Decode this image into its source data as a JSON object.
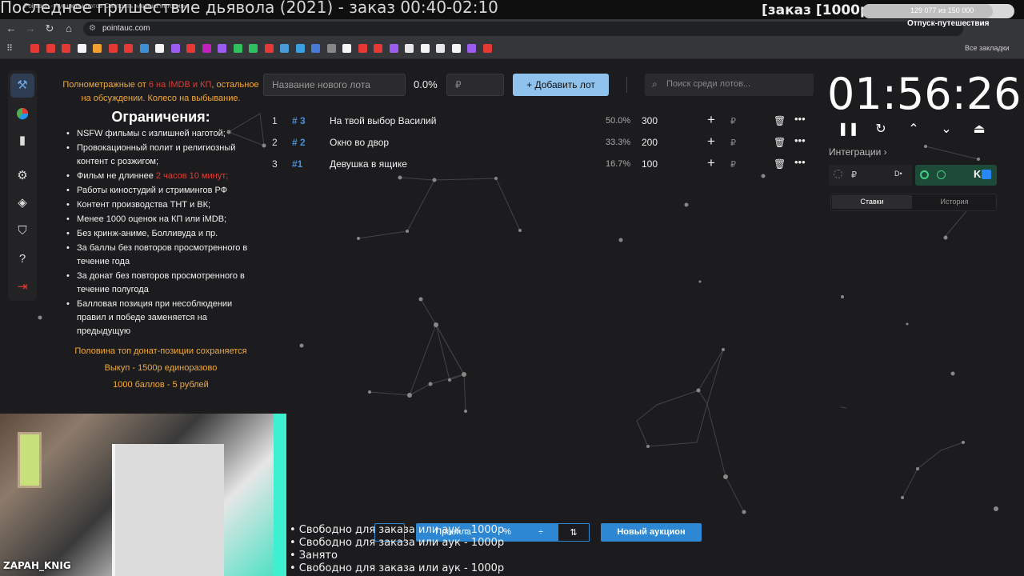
{
  "stream_overlay": {
    "title": "Последнее пришествие дьявола (2021) - заказ 00:40-02:10",
    "order_badge": "[заказ [1000р]",
    "progress_text": "129 077 из 150 000",
    "progress_fraction": 0.86,
    "ext_note": "Отпуск-путешествия",
    "lines": [
      "• Свободно для заказа или аук - 1000р",
      "• Свободно для заказа или аук - 1000р",
      "• Занято",
      "• Свободно для заказа или аук - 1000р"
    ],
    "cam_name": "ZAPAH_KNIG"
  },
  "browser": {
    "tab_strip": "Pointauc - Аукционы лотов    Смотреть «Анаша история»",
    "url": "pointauc.com",
    "all_bookmarks": "Все закладки",
    "bookmark_colors": [
      "#e53935",
      "#e53935",
      "#e53935",
      "#f5f5f5",
      "#f0a030",
      "#e53935",
      "#e53935",
      "#3f8fd8",
      "#f5f5f5",
      "#9c5cf0",
      "#e53935",
      "#c020c0",
      "#9c5cf0",
      "#30c060",
      "#30c060",
      "#e53935",
      "#4a9ad8",
      "#3aa0e0",
      "#4a7ad8",
      "#888888",
      "#f5f5f5",
      "#e53935",
      "#e53935",
      "#9c5cf0",
      "#e8e8e8",
      "#f5f5f5",
      "#e8e8e8",
      "#f5f5f5",
      "#9c5cf0",
      "#e53935"
    ]
  },
  "sidebar": {
    "icons": [
      "gavel-icon",
      "pie-chart-icon",
      "bar-chart-icon",
      "settings-icon",
      "layers-icon",
      "shield-icon",
      "help-icon",
      "logout-icon"
    ]
  },
  "rules": {
    "intro_pre": "Полнометражные от ",
    "intro_red": "6 на IMDB и КП",
    "intro_post": ", остальное на обсуждении. Колесо на выбывание.",
    "heading": "Ограничения:",
    "items": [
      "NSFW фильмы с излишней наготой;",
      "Провокационный полит и религиозный контент с розжигом;",
      "__length__",
      "Работы киностудий и стримингов РФ",
      "Контент производства ТНТ и ВК;",
      "Менее 1000 оценок на КП или iMDB;",
      "Без кринж-аниме, Болливуда и пр.",
      "За баллы без повторов просмотренного в течение года",
      "За донат без повторов просмотренного в течение полугода",
      "Балловая позиция при несоблюдении правил и победе заменяется на предыдущую"
    ],
    "length_pre": "Фильм не длиннее ",
    "length_red": "2 часов 10 минут;",
    "footer": [
      "Половина топ донат-позиции сохраняется",
      "Выкуп - 1500р единоразово",
      "1000 баллов - 5 рублей"
    ]
  },
  "toolbar": {
    "lot_name_placeholder": "Название нового лота",
    "percent": "0.0%",
    "amount_placeholder": "₽",
    "add_lot": "+  Добавить лот",
    "search_placeholder": "Поиск среди лотов..."
  },
  "lots": [
    {
      "idx": "1",
      "code": "# 3",
      "name": "На твой выбор Василий",
      "pct": "50.0%",
      "amount": "300"
    },
    {
      "idx": "2",
      "code": "# 2",
      "name": "Окно во двор",
      "pct": "33.3%",
      "amount": "200"
    },
    {
      "idx": "3",
      "code": "#1",
      "name": "Девушка в ящике",
      "pct": "16.7%",
      "amount": "100"
    }
  ],
  "lot_actions": {
    "plus": "+",
    "rub": "₽",
    "delete": "🗑",
    "more": "•••"
  },
  "timer": {
    "value": "01:56:26",
    "controls": [
      "pause-icon",
      "restart-icon",
      "chevron-up-icon",
      "chevron-down-icon",
      "eject-icon"
    ],
    "control_glyphs": [
      "❚❚",
      "↻",
      "⌃",
      "⌄",
      "⏏"
    ]
  },
  "integrations": {
    "label": "Интеграции  ›",
    "rub": "₽",
    "da": "D•",
    "vk": "K",
    "tabs": [
      "Ставки",
      "История"
    ]
  },
  "bottom_bar": {
    "rules_label": "Правила",
    "percent_glyph": "%",
    "divide_glyph": "÷",
    "sort_glyph": "⇅",
    "new_auction": "Новый аукцион"
  },
  "colors": {
    "accent": "#8fc3ee",
    "primary_button": "#2d87d3",
    "warning": "#f2a93b",
    "danger": "#e53935",
    "lot_code": "#4a90d9"
  }
}
